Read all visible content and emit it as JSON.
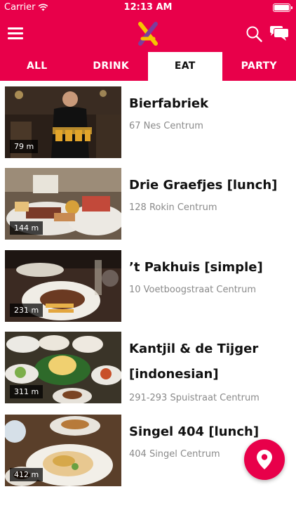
{
  "status_bar": {
    "carrier": "Carrier",
    "time": "12:13 AM"
  },
  "header": {
    "menu_icon": "hamburger-menu-icon",
    "logo_icon": "app-logo-cross",
    "search_icon": "search-icon",
    "chat_icon": "chat-bubbles-icon",
    "brand_color": "#e8004a"
  },
  "tabs": [
    {
      "label": "ALL",
      "active": false
    },
    {
      "label": "DRINK",
      "active": false
    },
    {
      "label": "EAT",
      "active": true
    },
    {
      "label": "PARTY",
      "active": false
    }
  ],
  "places": [
    {
      "name": "Bierfabriek",
      "address": "67 Nes Centrum",
      "distance": "79 m",
      "photo": "bartender-serving-beer"
    },
    {
      "name": "Drie Graefjes [lunch]",
      "address": "128 Rokin Centrum",
      "distance": "144 m",
      "photo": "lunch-platter"
    },
    {
      "name": "’t Pakhuis [simple]",
      "address": "10 Voetboogstraat Centrum",
      "distance": "231 m",
      "photo": "steak-and-fries"
    },
    {
      "name": "Kantjil & de Tijger [indonesian]",
      "address": "291-293 Spuistraat Centrum",
      "distance": "311 m",
      "photo": "indonesian-rice-table"
    },
    {
      "name": "Singel 404 [lunch]",
      "address": "404 Singel Centrum",
      "distance": "412 m",
      "photo": "quiche-and-coffee"
    }
  ],
  "fab": {
    "icon": "map-pin-icon"
  }
}
